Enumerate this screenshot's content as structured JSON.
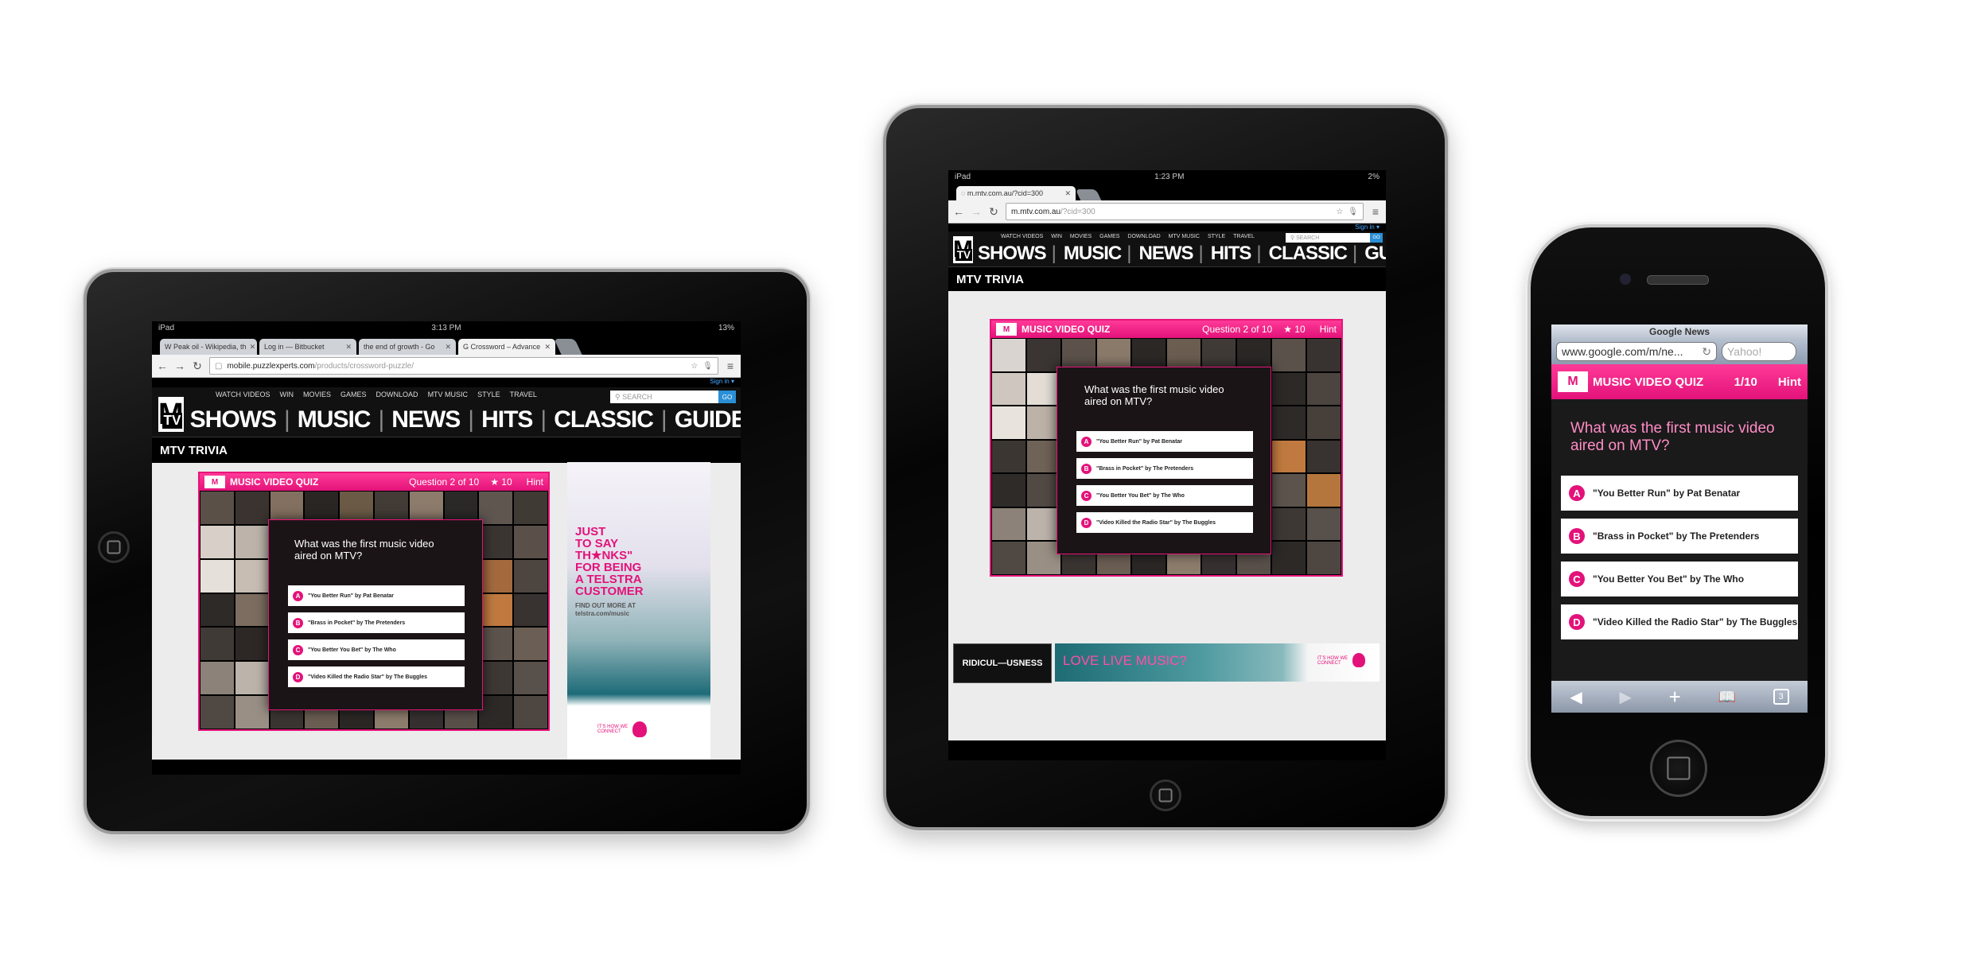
{
  "left_ipad": {
    "status": {
      "device": "iPad",
      "time": "3:13 PM",
      "battery": "13%"
    },
    "tabs": [
      {
        "icon": "W",
        "label": "Peak oil - Wikipedia, th"
      },
      {
        "icon": "",
        "label": "Log in — Bitbucket"
      },
      {
        "icon": "",
        "label": "the end of growth - Go"
      },
      {
        "icon": "G",
        "label": "Crossword – Advance"
      }
    ],
    "url": {
      "host": "mobile.puzzlexperts.com",
      "path": "/products/crossword-puzzle/"
    },
    "ad": {
      "line1": "JUST",
      "line2": "TO SAY",
      "line3": "TH★NKS\"",
      "line4": "FOR BEING",
      "line5": "A TELSTRA",
      "line6": "CUSTOMER",
      "find1": "FIND OUT MORE AT",
      "find2": "telstra.com/music",
      "tagline": "IT'S HOW WE CONNECT"
    }
  },
  "middle_ipad": {
    "status": {
      "device": "iPad",
      "time": "1:23 PM",
      "battery": "2%"
    },
    "tabs": [
      {
        "label": "m.mtv.com.au/?cid=300"
      }
    ],
    "url": {
      "host": "m.mtv.com.au",
      "path": "/?cid=300"
    },
    "banner": {
      "left": "RIDICUL—USNESS",
      "main": "LOVE LIVE MUSIC?",
      "tagline": "IT'S HOW WE CONNECT"
    }
  },
  "mtv": {
    "signin": "Sign in ▾",
    "logo_m": "M",
    "logo_tv": "TV",
    "subnav": [
      "WATCH VIDEOS",
      "WIN",
      "MOVIES",
      "GAMES",
      "DOWNLOAD",
      "MTV MUSIC",
      "STYLE",
      "TRAVEL"
    ],
    "search_placeholder": "SEARCH",
    "search_go": "GO",
    "bignav": [
      "SHOWS",
      "MUSIC",
      "NEWS",
      "HITS",
      "CLASSIC",
      "GUIDE"
    ],
    "trivia_title": "MTV TRIVIA"
  },
  "quiz": {
    "title": "MUSIC VIDEO QUIZ",
    "progress": "Question 2 of 10",
    "score": "★ 10",
    "hint": "Hint",
    "question": "What was the first music video aired on MTV?",
    "answers": [
      {
        "letter": "A",
        "text": "\"You Better Run\" by Pat Benatar"
      },
      {
        "letter": "B",
        "text": "\"Brass in Pocket\" by The Pretenders"
      },
      {
        "letter": "C",
        "text": "\"You Better You Bet\" by The Who"
      },
      {
        "letter": "D",
        "text": "\"Video Killed the Radio Star\" by The Buggles"
      }
    ]
  },
  "iphone": {
    "title": "Google News",
    "url": "www.google.com/m/ne...",
    "search": "Yahoo!",
    "quiz_progress": "1/10",
    "toolbar": [
      "◀",
      "▶",
      "+",
      "📖",
      "3"
    ]
  },
  "colors": {
    "pink": "#e3127a",
    "dark": "#111111",
    "link_blue": "#2a8fd6"
  }
}
